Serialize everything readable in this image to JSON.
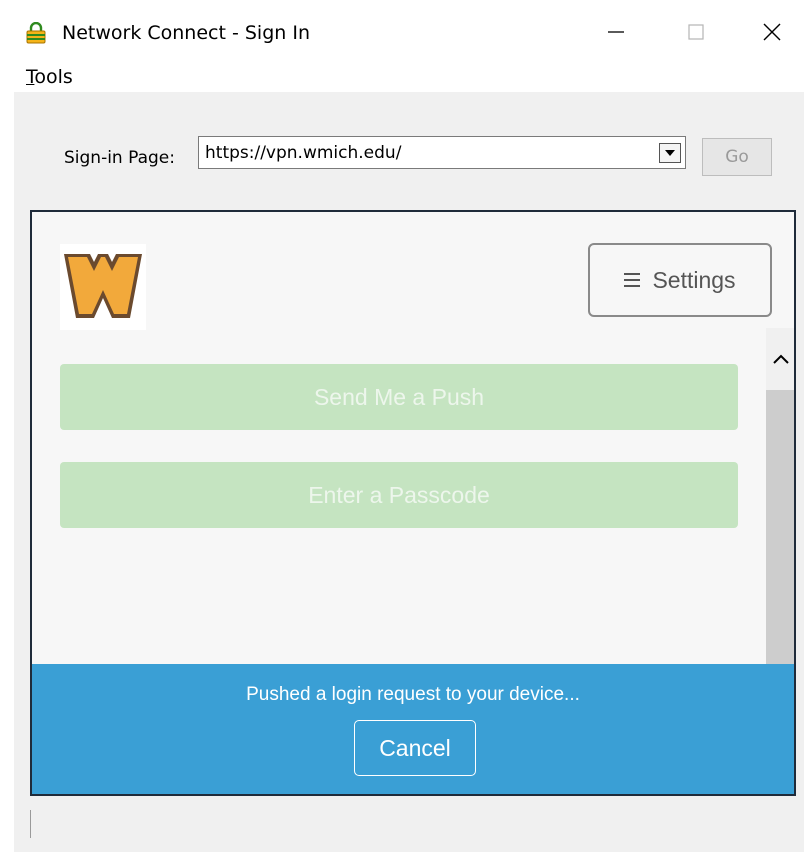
{
  "window": {
    "title": "Network Connect - Sign In",
    "icon": "padlock-icon"
  },
  "menu": {
    "tools_accel": "T",
    "tools_rest": "ools"
  },
  "signin": {
    "label": "Sign-in Page:",
    "url": "https://vpn.wmich.edu/",
    "go_label": "Go"
  },
  "page": {
    "logo_letter": "W",
    "settings_label": "Settings",
    "push_label": "Send Me a Push",
    "passcode_label": "Enter a Passcode",
    "status_text": "Pushed a login request to your device...",
    "cancel_label": "Cancel"
  },
  "colors": {
    "accent_blue": "#3a9fd5",
    "disabled_green": "#c5e4c1",
    "logo_gold": "#f2a93b",
    "logo_brown": "#6b4a2e"
  }
}
